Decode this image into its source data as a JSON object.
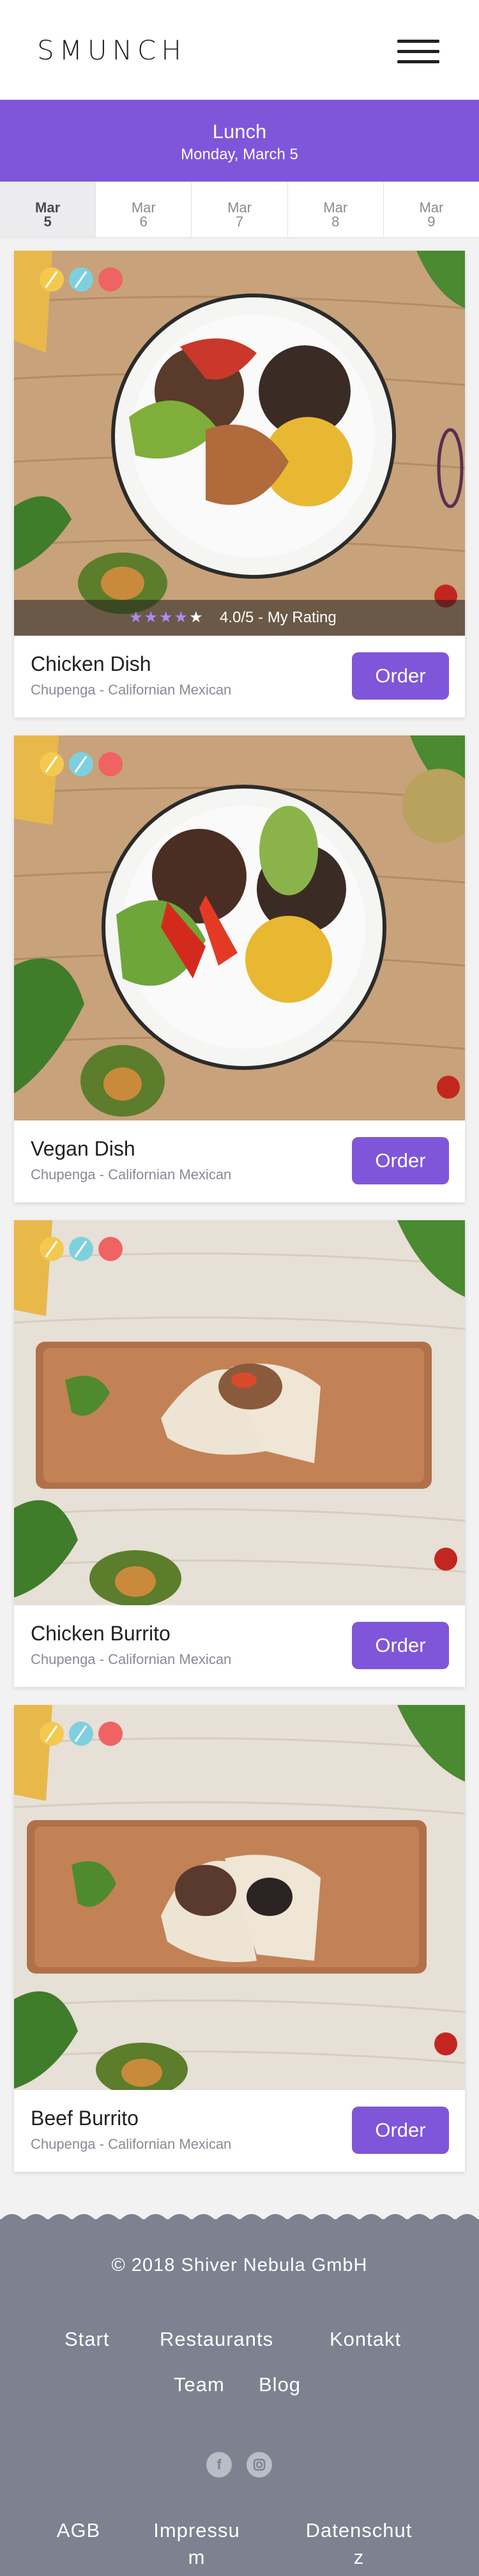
{
  "header": {
    "logo": "SMUNCH",
    "menu_icon": "hamburger-icon"
  },
  "banner": {
    "title": "Lunch",
    "date": "Monday, March 5"
  },
  "date_tabs": [
    {
      "month": "Mar",
      "day": "5",
      "active": true
    },
    {
      "month": "Mar",
      "day": "6",
      "active": false
    },
    {
      "month": "Mar",
      "day": "7",
      "active": false
    },
    {
      "month": "Mar",
      "day": "8",
      "active": false
    },
    {
      "month": "Mar",
      "day": "9",
      "active": false
    }
  ],
  "dishes": [
    {
      "name": "Chicken Dish",
      "restaurant": "Chupenga - Californian Mexican",
      "order_label": "Order",
      "rating": {
        "stars": 4,
        "max": 5,
        "text": "4.0/5  - My Rating"
      }
    },
    {
      "name": "Vegan Dish",
      "restaurant": "Chupenga - Californian Mexican",
      "order_label": "Order"
    },
    {
      "name": "Chicken Burrito",
      "restaurant": "Chupenga - Californian Mexican",
      "order_label": "Order"
    },
    {
      "name": "Beef Burrito",
      "restaurant": "Chupenga - Californian Mexican",
      "order_label": "Order"
    }
  ],
  "footer": {
    "copyright": "© 2018 Shiver Nebula GmbH",
    "nav": [
      "Start",
      "Restaurants",
      "Kontakt",
      "Team",
      "Blog"
    ],
    "social_icons": [
      "facebook-icon",
      "instagram-icon"
    ],
    "legal": [
      "AGB",
      "Impressu\nm",
      "Datenschut\nz"
    ]
  },
  "colors": {
    "accent": "#7f56d9",
    "footer": "#7c8290",
    "dot_yellow": "#f3c94f",
    "dot_blue": "#7ed0df",
    "dot_red": "#ef6363"
  }
}
